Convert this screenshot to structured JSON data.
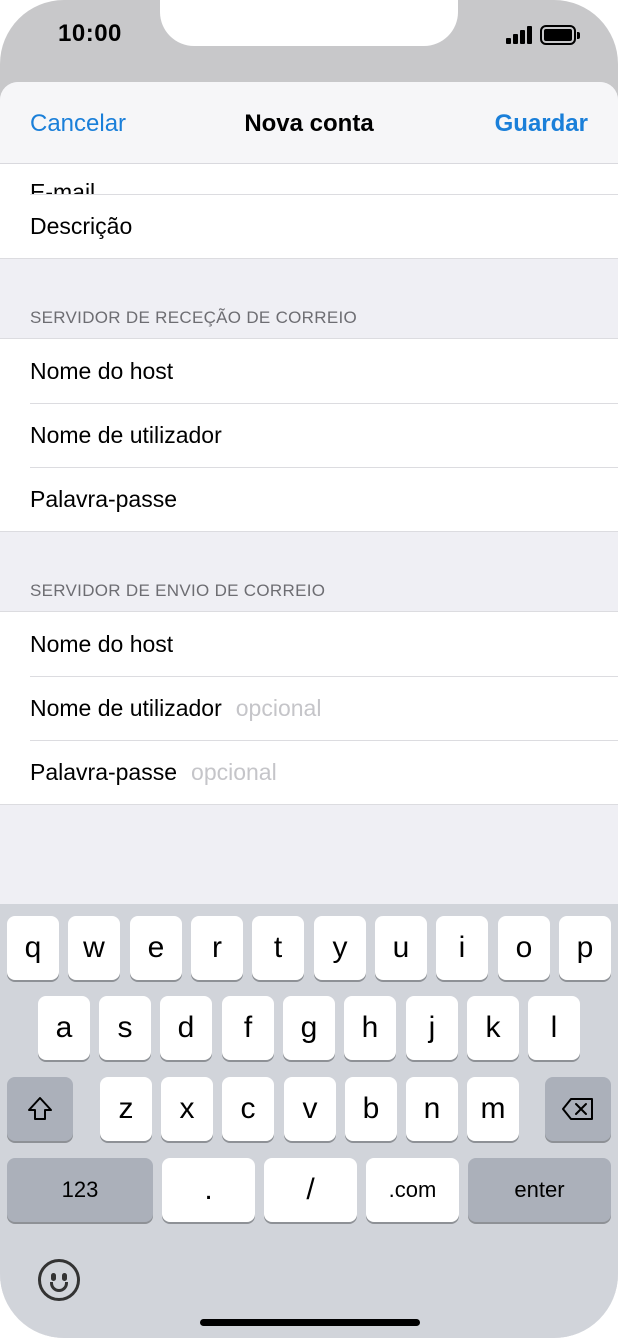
{
  "status_bar": {
    "time": "10:00"
  },
  "nav": {
    "cancel": "Cancelar",
    "title": "Nova conta",
    "save": "Guardar"
  },
  "form": {
    "top_rows": [
      {
        "label": "E-mail"
      },
      {
        "label": "Descrição"
      }
    ],
    "incoming": {
      "header": "SERVIDOR DE RECEÇÃO DE CORREIO",
      "rows": [
        {
          "label": "Nome do host"
        },
        {
          "label": "Nome de utilizador"
        },
        {
          "label": "Palavra-passe"
        }
      ]
    },
    "outgoing": {
      "header": "SERVIDOR DE ENVIO DE CORREIO",
      "rows": [
        {
          "label": "Nome do host",
          "placeholder": ""
        },
        {
          "label": "Nome de utilizador",
          "placeholder": "opcional"
        },
        {
          "label": "Palavra-passe",
          "placeholder": "opcional"
        }
      ]
    }
  },
  "keyboard": {
    "row1": [
      "q",
      "w",
      "e",
      "r",
      "t",
      "y",
      "u",
      "i",
      "o",
      "p"
    ],
    "row2": [
      "a",
      "s",
      "d",
      "f",
      "g",
      "h",
      "j",
      "k",
      "l"
    ],
    "row3": [
      "z",
      "x",
      "c",
      "v",
      "b",
      "n",
      "m"
    ],
    "numbers_key": "123",
    "dot_key": ".",
    "slash_key": "/",
    "dotcom_key": ".com",
    "enter_key": "enter",
    "icons": [
      "shift-icon",
      "backspace-icon",
      "emoji-icon"
    ]
  },
  "colors": {
    "accent": "#1a7fd9",
    "keyboard_bg": "#d1d4da",
    "dark_key": "#abb0ba"
  }
}
